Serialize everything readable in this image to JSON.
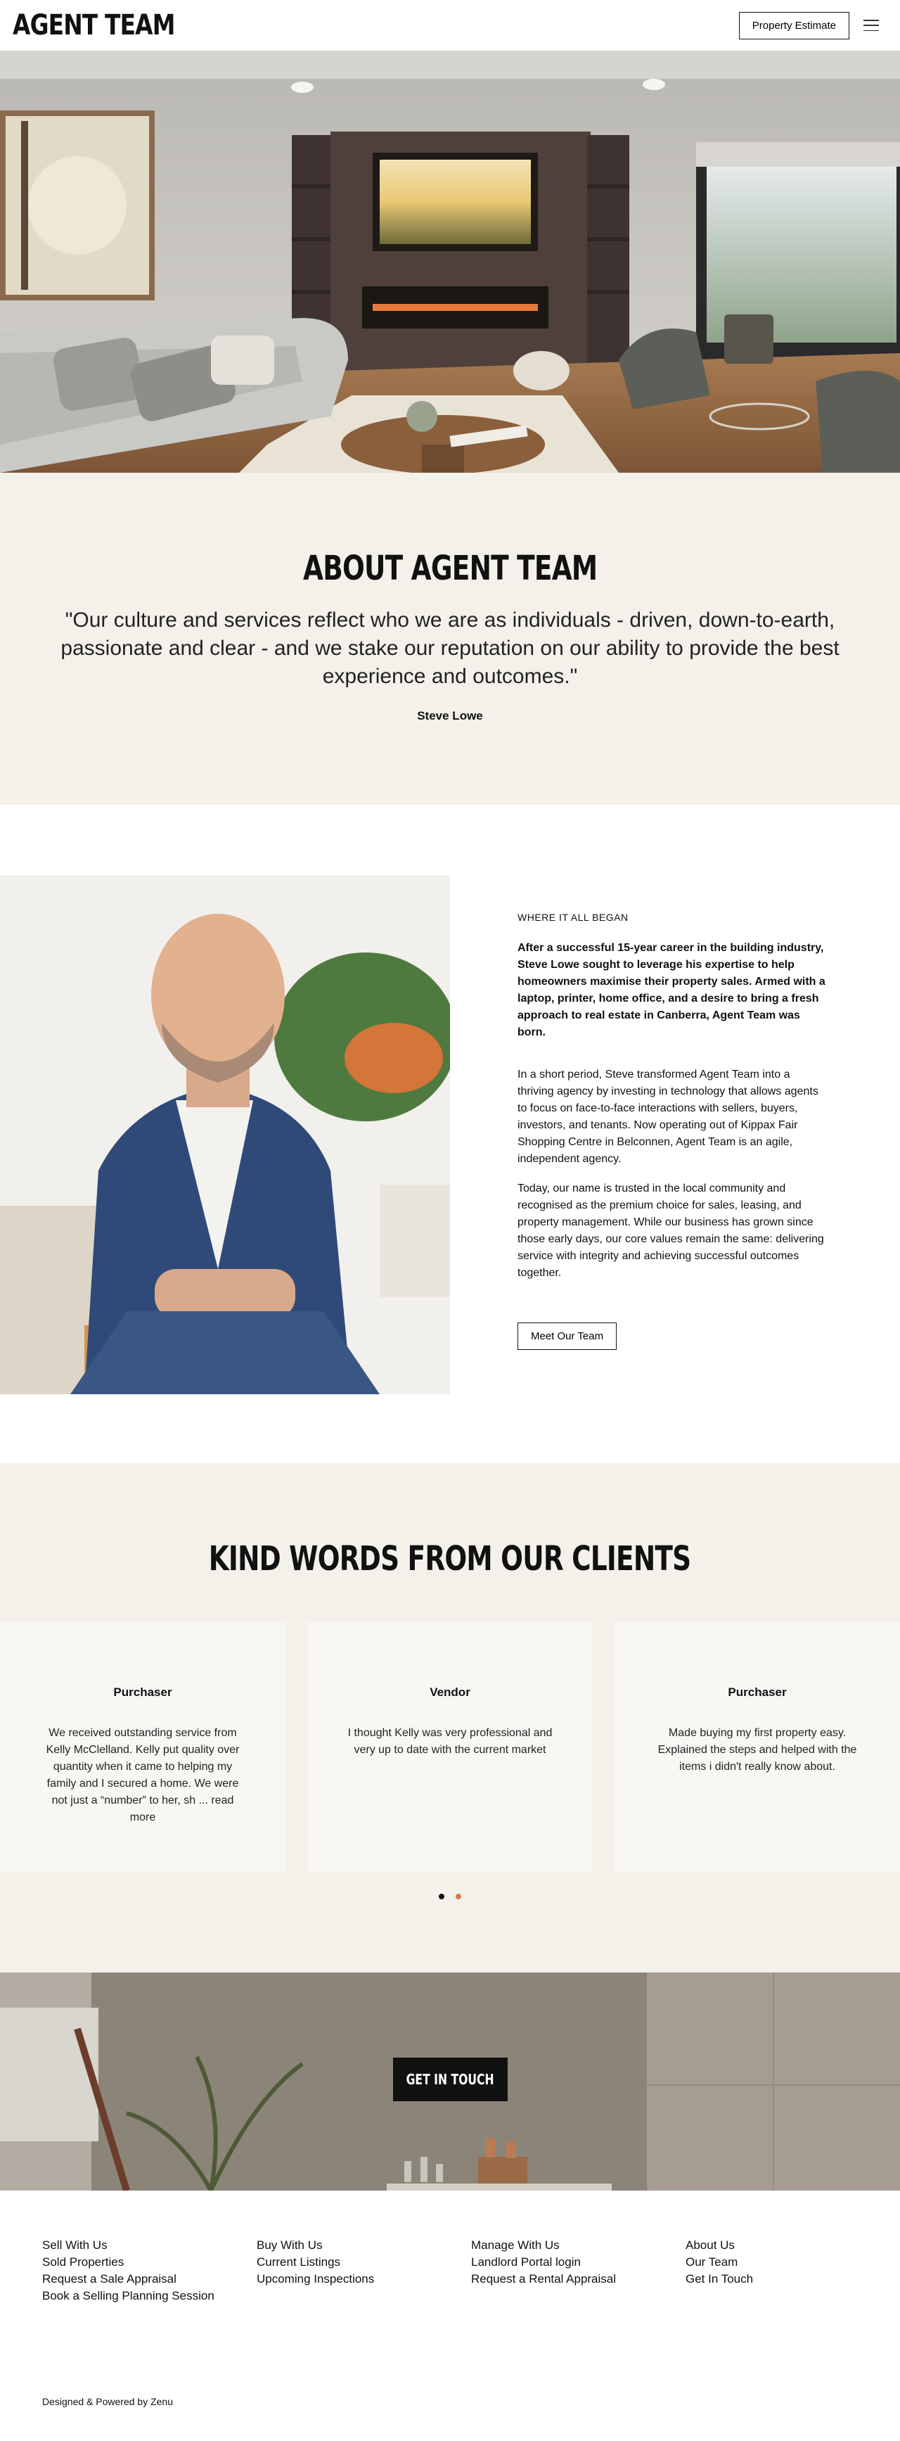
{
  "header": {
    "logo": "AGENT TEAM",
    "estimate_label": "Property Estimate"
  },
  "about": {
    "title": "ABOUT AGENT TEAM",
    "quote": "\"Our culture and services reflect who we are as individuals - driven, down-to-earth, passionate and clear - and we stake our reputation on our ability to provide the best experience and outcomes.\"",
    "author": "Steve Lowe"
  },
  "story": {
    "eyebrow": "WHERE IT ALL BEGAN",
    "lead": "After a successful 15-year career in the building industry, Steve Lowe sought to leverage his expertise to help homeowners maximise their property sales. Armed with a laptop, printer, home office, and a desire to bring a fresh approach to real estate in Canberra, Agent Team was born.",
    "para1": "In a short period, Steve transformed Agent Team into a thriving agency by investing in technology that allows agents to focus on face-to-face interactions with sellers, buyers, investors, and tenants. Now operating out of Kippax Fair Shopping Centre in Belconnen, Agent Team is an agile, independent agency.",
    "para2": "Today, our name is trusted in the local community and recognised as the premium choice for sales, leasing, and property management. While our business has grown since those early days, our core values remain the same: delivering service with integrity and achieving successful outcomes together.",
    "button_label": "Meet Our Team"
  },
  "testimonials": {
    "title": "KIND WORDS FROM OUR CLIENTS",
    "cards": [
      {
        "role": "Purchaser",
        "text": "We received outstanding service from Kelly McClelland.  Kelly put quality over quantity when it came to helping my family and I secured a home.   We were not just a “number” to her, sh ... read more"
      },
      {
        "role": "Vendor",
        "text": "I thought Kelly was very professional and very up to date with the current market"
      },
      {
        "role": "Purchaser",
        "text": "Made buying my first property easy. Explained the steps and helped with the items i didn't really know about."
      }
    ]
  },
  "cta": {
    "label": "GET IN TOUCH"
  },
  "footer": {
    "col1": [
      "Sell With Us",
      "Sold Properties",
      "Request a Sale Appraisal",
      "Book a Selling Planning Session"
    ],
    "col2": [
      "Buy With Us",
      "Current Listings",
      "Upcoming Inspections"
    ],
    "col3": [
      "Manage With Us",
      "Landlord Portal login",
      "Request a Rental Appraisal"
    ],
    "col4": [
      "About Us",
      "Our Team",
      "Get In Touch"
    ],
    "credit": "Designed & Powered by Zenu"
  },
  "colors": {
    "beige_background": "#f4f1eb",
    "accent_dot": "#d27a4a",
    "button_dark": "#111111"
  }
}
